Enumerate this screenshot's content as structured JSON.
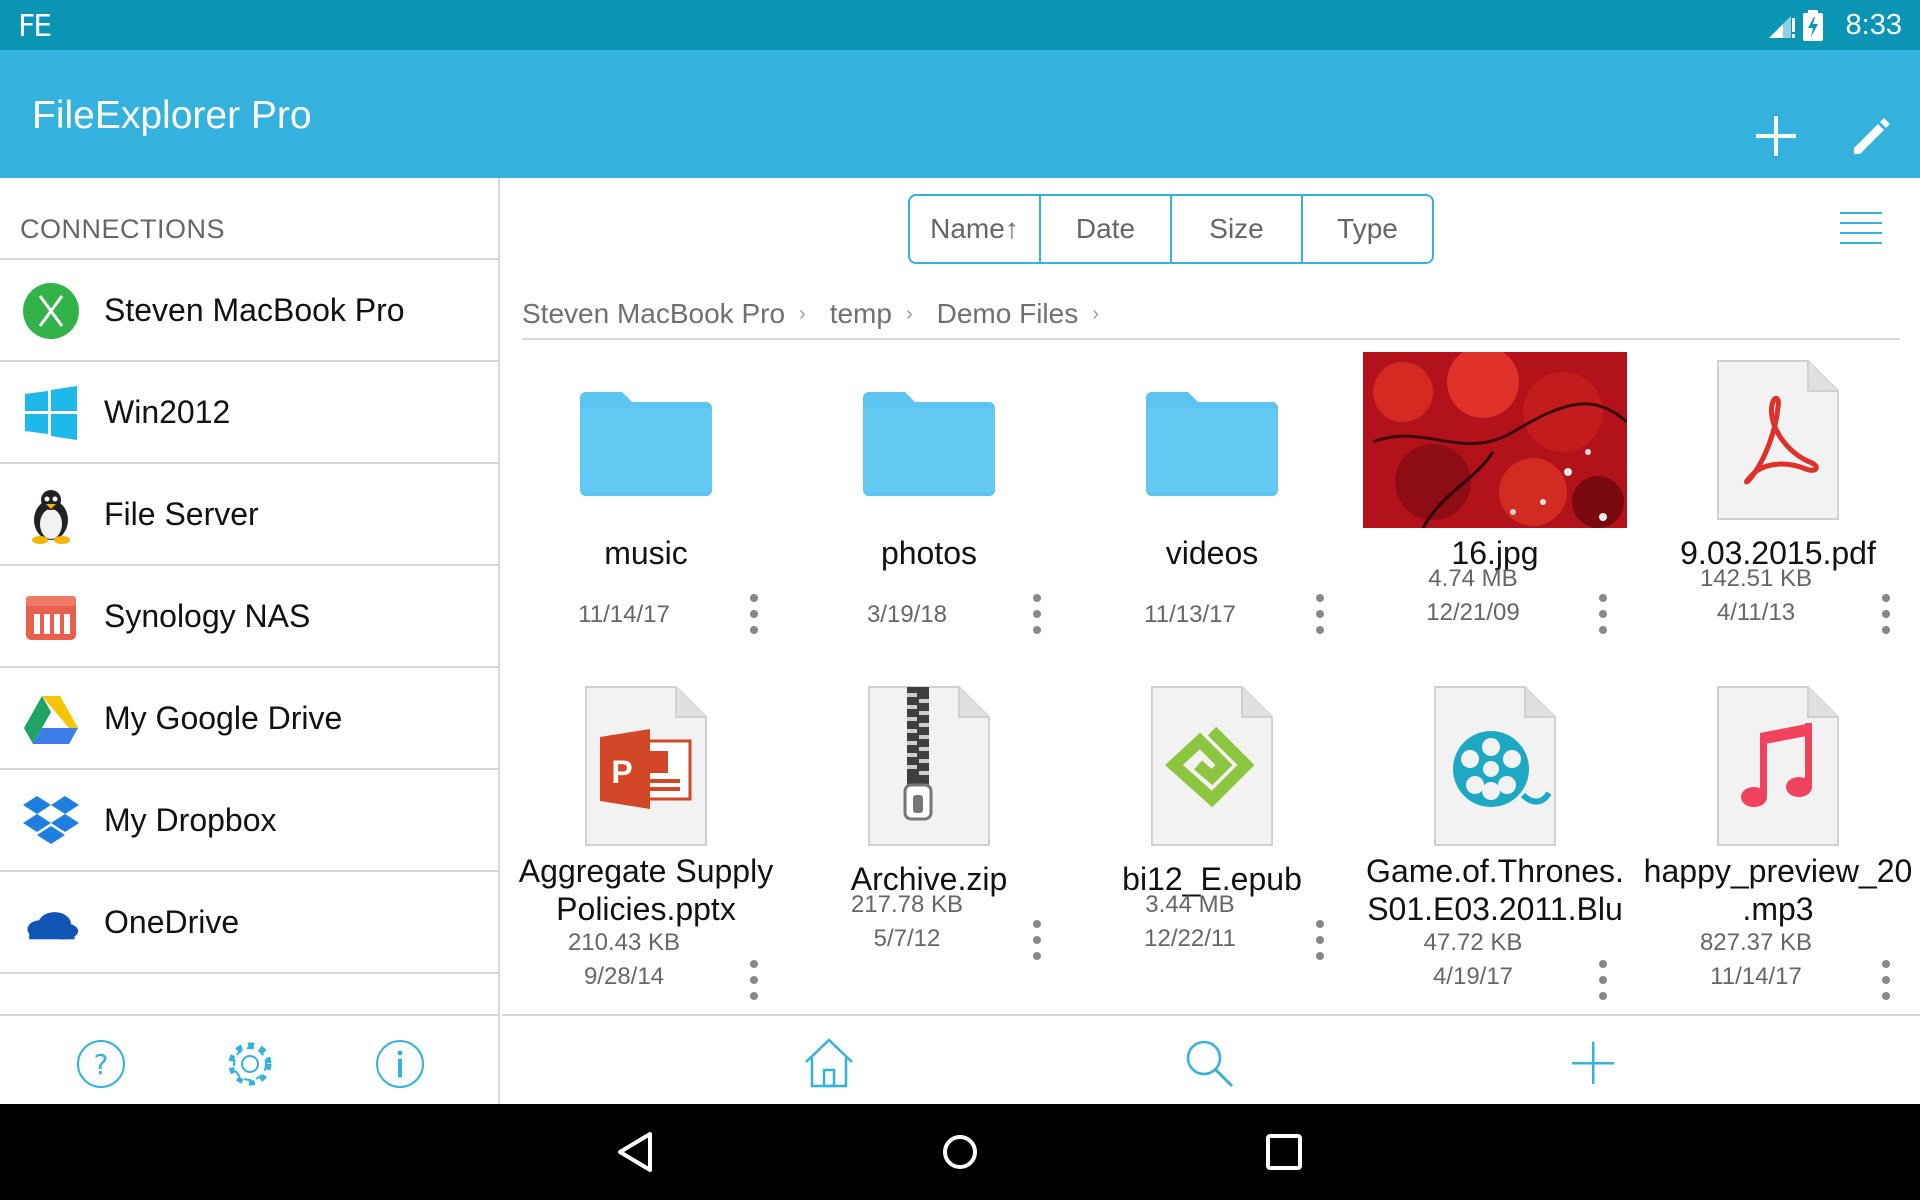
{
  "status_bar": {
    "app_badge": "FE",
    "time": "8:33",
    "icons": [
      "signal-icon",
      "battery-charging-icon"
    ]
  },
  "app_bar": {
    "title": "FileExplorer Pro",
    "actions": [
      "add-icon",
      "edit-pencil-icon"
    ]
  },
  "sidebar": {
    "heading": "CONNECTIONS",
    "connections": [
      {
        "label": "Steven MacBook Pro",
        "icon": "mac-x-icon"
      },
      {
        "label": "Win2012",
        "icon": "windows-icon"
      },
      {
        "label": "File Server",
        "icon": "linux-penguin-icon"
      },
      {
        "label": "Synology NAS",
        "icon": "nas-icon"
      },
      {
        "label": "My Google Drive",
        "icon": "google-drive-icon"
      },
      {
        "label": "My Dropbox",
        "icon": "dropbox-icon"
      },
      {
        "label": "OneDrive",
        "icon": "onedrive-icon"
      }
    ],
    "footer": [
      "help-icon",
      "settings-gear-icon",
      "info-icon"
    ]
  },
  "sort": {
    "options": [
      "Name↑",
      "Date",
      "Size",
      "Type"
    ],
    "active": "Name↑"
  },
  "breadcrumb": [
    "Steven MacBook Pro",
    "temp",
    "Demo Files"
  ],
  "files": [
    {
      "name": "music",
      "size": "",
      "date": "11/14/17",
      "kind": "folder"
    },
    {
      "name": "photos",
      "size": "",
      "date": "3/19/18",
      "kind": "folder"
    },
    {
      "name": "videos",
      "size": "",
      "date": "11/13/17",
      "kind": "folder"
    },
    {
      "name": "16.jpg",
      "size": "4.74 MB",
      "date": "12/21/09",
      "kind": "image"
    },
    {
      "name": "9.03.2015.pdf",
      "size": "142.51 KB",
      "date": "4/11/13",
      "kind": "pdf"
    },
    {
      "name": "Aggregate Supply\nPolicies.pptx",
      "size": "210.43 KB",
      "date": "9/28/14",
      "kind": "pptx"
    },
    {
      "name": "Archive.zip",
      "size": "217.78 KB",
      "date": "5/7/12",
      "kind": "zip"
    },
    {
      "name": "bi12_E.epub",
      "size": "3.44 MB",
      "date": "12/22/11",
      "kind": "epub"
    },
    {
      "name": "Game.of.Thrones.\nS01.E03.2011.Blu",
      "size": "47.72 KB",
      "date": "4/19/17",
      "kind": "video"
    },
    {
      "name": "happy_preview_20\n.mp3",
      "size": "827.37 KB",
      "date": "11/14/17",
      "kind": "audio"
    }
  ],
  "bottom_bar": [
    "home-icon",
    "search-icon",
    "add-icon"
  ],
  "nav_bar": [
    "back-icon",
    "home-circle-icon",
    "recents-icon"
  ],
  "colors": {
    "status_bar": "#0a95b5",
    "app_bar": "#34b1dc",
    "accent": "#34b1dc",
    "folder": "#5bc4f0"
  }
}
